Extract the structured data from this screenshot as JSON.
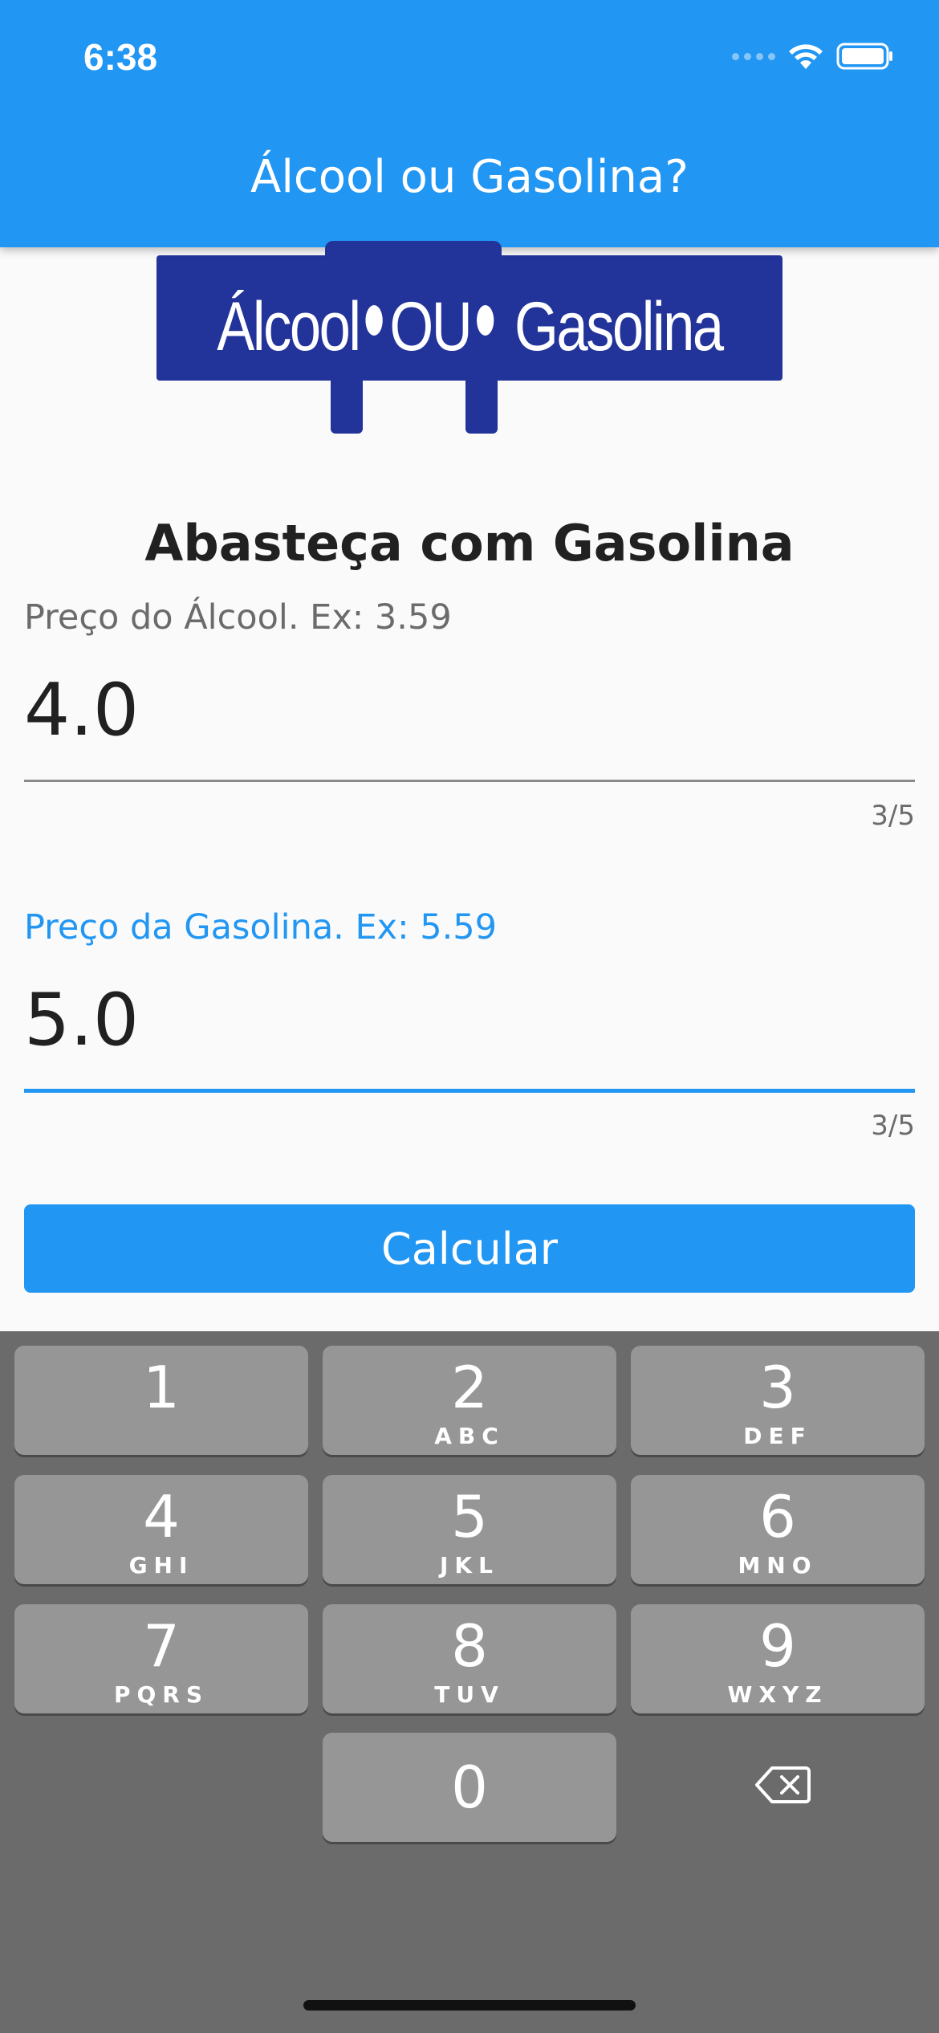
{
  "status_bar": {
    "time": "6:38",
    "icons": [
      "signal-icon",
      "wifi-icon",
      "battery-icon"
    ]
  },
  "appbar": {
    "title": "Álcool ou Gasolina?",
    "color": "#2196f3"
  },
  "logo": {
    "left": "Álcool",
    "middle": "OU",
    "right": "Gasolina",
    "color": "#22339a"
  },
  "result": {
    "text": "Abasteça com Gasolina"
  },
  "alcool_field": {
    "label": "Preço do Álcool. Ex: 3.59",
    "value": "4.0",
    "counter": "3/5"
  },
  "gasolina_field": {
    "label": "Preço da Gasolina. Ex: 5.59",
    "value": "5.0",
    "counter": "3/5"
  },
  "calculate_button": {
    "label": "Calcular"
  },
  "keyboard": {
    "keys": [
      {
        "num": "1",
        "letters": ""
      },
      {
        "num": "2",
        "letters": "ABC"
      },
      {
        "num": "3",
        "letters": "DEF"
      },
      {
        "num": "4",
        "letters": "GHI"
      },
      {
        "num": "5",
        "letters": "JKL"
      },
      {
        "num": "6",
        "letters": "MNO"
      },
      {
        "num": "7",
        "letters": "PQRS"
      },
      {
        "num": "8",
        "letters": "TUV"
      },
      {
        "num": "9",
        "letters": "WXYZ"
      },
      {
        "num": "0",
        "letters": ""
      }
    ],
    "backspace_icon": "backspace-icon"
  }
}
